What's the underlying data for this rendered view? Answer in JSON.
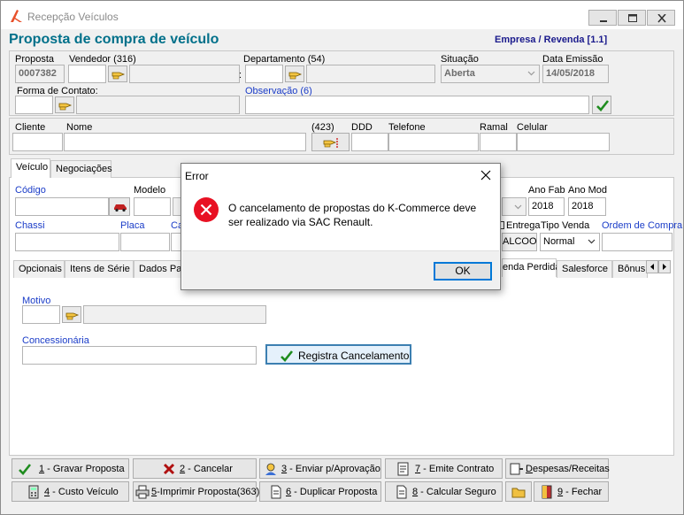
{
  "window": {
    "title": "Recepção Veículos"
  },
  "header": {
    "title": "Proposta de compra de veículo",
    "company": "Empresa / Revenda [1.1]"
  },
  "proposal": {
    "proposta_label": "Proposta",
    "proposta_value": "0007382",
    "vendedor_label": "Vendedor (316)",
    "vendedor_value": "",
    "departamento_label": "Departamento (54)",
    "situacao_label": "Situação",
    "situacao_value": "Aberta",
    "data_label": "Data Emissão",
    "data_value": "14/05/2018",
    "forma_label": "Forma de Contato:",
    "observacao_label": "Observação (6)",
    "colon": ":"
  },
  "client": {
    "cliente_label": "Cliente",
    "nome_label": "Nome",
    "count_label": "(423)",
    "ddd_label": "DDD",
    "telefone_label": "Telefone",
    "ramal_label": "Ramal",
    "celular_label": "Celular"
  },
  "tabs": [
    "Veículo",
    "Negociações"
  ],
  "vehicle": {
    "codigo_label": "Código",
    "modelo_label": "Modelo",
    "ano_fab_label": "Ano Fab",
    "ano_fab_value": "2018",
    "ano_mod_label": "Ano Mod",
    "ano_mod_value": "2018",
    "chassi_label": "Chassi",
    "placa_label": "Placa",
    "ca_label": "Ca",
    "entrega_label": "Entrega",
    "combustivel_value": "ALCOOL",
    "tipo_venda_label": "Tipo Venda",
    "tipo_venda_value": "Normal",
    "ordem_label": "Ordem de Compra"
  },
  "subtabs": {
    "left": [
      "Opcionais",
      "Itens de Série",
      "Dados Pa"
    ],
    "right": [
      "enda Perdida",
      "Salesforce",
      "Bônus"
    ]
  },
  "lost_sale": {
    "motivo_label": "Motivo",
    "concessionaria_label": "Concessionária",
    "registra_label": "Registra Cancelamento"
  },
  "actions": [
    {
      "key": "1",
      "label": " - Gravar Proposta"
    },
    {
      "key": "2",
      "label": " - Cancelar"
    },
    {
      "key": "3",
      "label": " - Enviar p/Aprovação"
    },
    {
      "key": "7",
      "label": " - Emite Contrato"
    },
    {
      "key": "D",
      "label": "espesas/Receitas"
    },
    {
      "key": "4",
      "label": " - Custo Veículo"
    },
    {
      "key": "5",
      "label": "-Imprimir Proposta(363)"
    },
    {
      "key": "6",
      "label": " - Duplicar Proposta"
    },
    {
      "key": "8",
      "label": " - Calcular Seguro"
    },
    {
      "key": "9",
      "label": " - Fechar"
    }
  ],
  "dialog": {
    "title": "Error",
    "message": "O cancelamento de propostas do K-Commerce deve ser realizado via SAC Renault.",
    "ok_label": "OK"
  },
  "colors": {
    "title_teal": "#00708a",
    "company_blue": "#1a1a8c",
    "link_blue": "#1a3cc8",
    "error_red": "#e81123",
    "ok_border": "#0078d7"
  }
}
